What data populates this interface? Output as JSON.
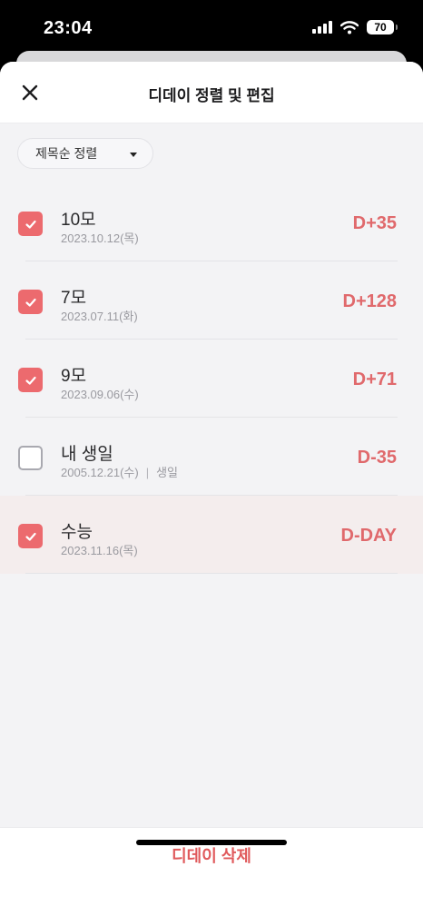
{
  "status_bar": {
    "time": "23:04",
    "battery": "70",
    "icons": [
      "signal-icon",
      "wifi-icon",
      "battery-icon"
    ]
  },
  "header": {
    "title": "디데이 정렬 및 편집",
    "close_icon": "close-icon"
  },
  "sort": {
    "label": "제목순 정렬",
    "icon": "caret-down-icon"
  },
  "items": [
    {
      "title": "10모",
      "date": "2023.10.12(목)",
      "tag": "",
      "count": "D+35",
      "checked": true,
      "selected": false
    },
    {
      "title": "7모",
      "date": "2023.07.11(화)",
      "tag": "",
      "count": "D+128",
      "checked": true,
      "selected": false
    },
    {
      "title": "9모",
      "date": "2023.09.06(수)",
      "tag": "",
      "count": "D+71",
      "checked": true,
      "selected": false
    },
    {
      "title": "내 생일",
      "date": "2005.12.21(수)",
      "separator": "|",
      "tag": "생일",
      "count": "D-35",
      "checked": false,
      "selected": false
    },
    {
      "title": "수능",
      "date": "2023.11.16(목)",
      "tag": "",
      "count": "D-DAY",
      "checked": true,
      "selected": true
    }
  ],
  "footer": {
    "delete_label": "디데이 삭제"
  },
  "colors": {
    "accent": "#ec6a6e",
    "count_text": "#e0696c",
    "delete_text": "#e05a5c",
    "sheet_bg": "#f3f3f5",
    "selected_row_bg": "#f4eded"
  }
}
